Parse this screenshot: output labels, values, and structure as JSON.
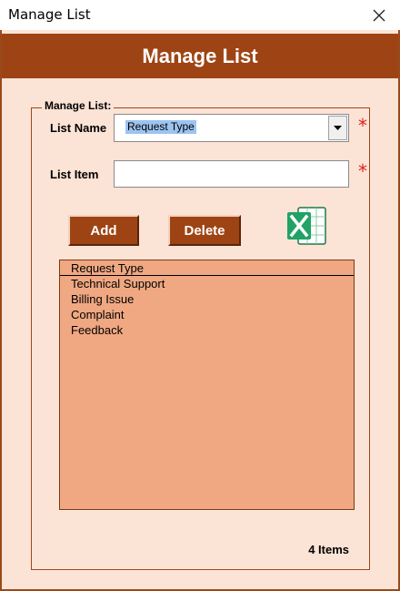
{
  "window": {
    "title": "Manage List"
  },
  "header": {
    "title": "Manage List"
  },
  "frame": {
    "label": "Manage List:"
  },
  "fields": {
    "list_name_label": "List Name",
    "list_name_value": "Request Type",
    "list_item_label": "List Item",
    "list_item_value": "",
    "required_marker": "*"
  },
  "buttons": {
    "add": "Add",
    "delete": "Delete"
  },
  "list": {
    "header": "Request Type",
    "items": [
      "Technical Support",
      "Billing Issue",
      "Complaint",
      "Feedback"
    ]
  },
  "status": {
    "count": "4 Items"
  },
  "icons": {
    "close": "close-icon",
    "dropdown": "chevron-down-icon",
    "excel": "excel-icon"
  },
  "colors": {
    "accent": "#9e4414",
    "background": "#fbe3d6",
    "list_bg": "#f0a882",
    "required": "#e02020",
    "selection": "#9dc3f0"
  }
}
